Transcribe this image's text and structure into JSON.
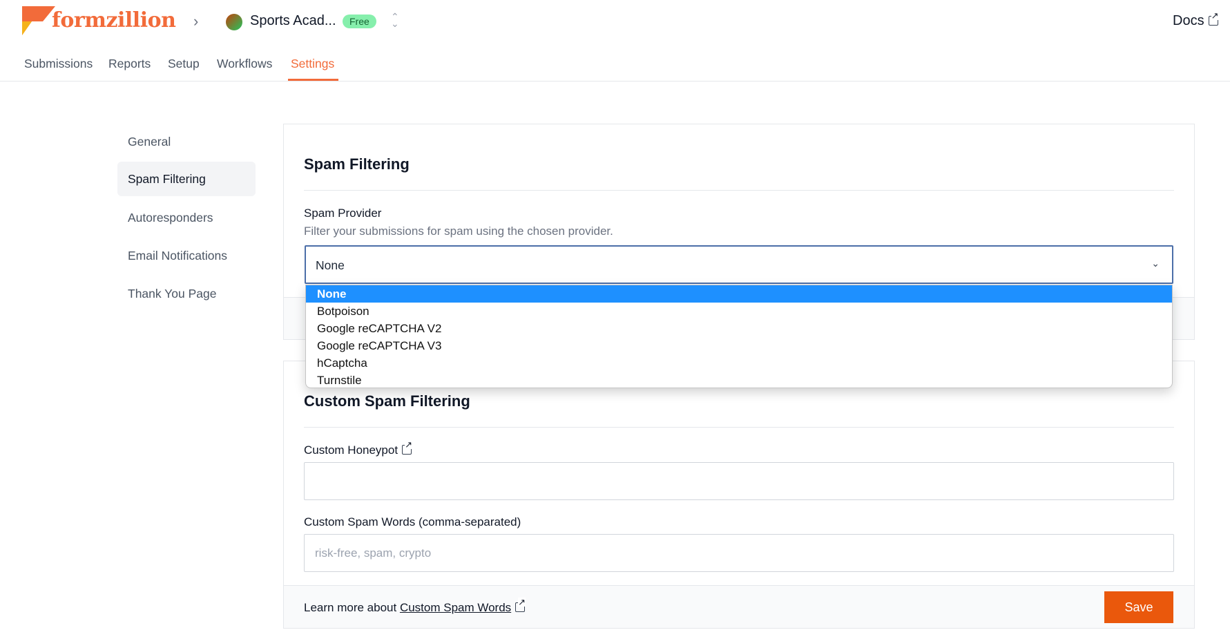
{
  "brand": {
    "name": "formzillion",
    "accent": "#f26b3a"
  },
  "header": {
    "workspace": "Sports Acad...",
    "plan_badge": "Free",
    "docs": "Docs"
  },
  "nav": {
    "tabs": [
      {
        "label": "Submissions"
      },
      {
        "label": "Reports"
      },
      {
        "label": "Setup"
      },
      {
        "label": "Workflows"
      },
      {
        "label": "Settings",
        "active": true
      }
    ]
  },
  "sidebar": {
    "items": [
      {
        "label": "General"
      },
      {
        "label": "Spam Filtering",
        "active": true
      },
      {
        "label": "Autoresponders"
      },
      {
        "label": "Email Notifications"
      },
      {
        "label": "Thank You Page"
      }
    ]
  },
  "spam": {
    "title": "Spam Filtering",
    "provider_label": "Spam Provider",
    "provider_help": "Filter your submissions for spam using the chosen provider.",
    "selected": "None",
    "options": [
      "None",
      "Botpoison",
      "Google reCAPTCHA V2",
      "Google reCAPTCHA V3",
      "hCaptcha",
      "Turnstile"
    ]
  },
  "custom": {
    "title": "Custom Spam Filtering",
    "honeypot_label": "Custom Honeypot",
    "honeypot_value": "",
    "words_label": "Custom Spam Words (comma-separated)",
    "words_placeholder": "risk-free, spam, crypto",
    "learn_prefix": "Learn more about",
    "learn_link": "Custom Spam Words",
    "save": "Save"
  }
}
